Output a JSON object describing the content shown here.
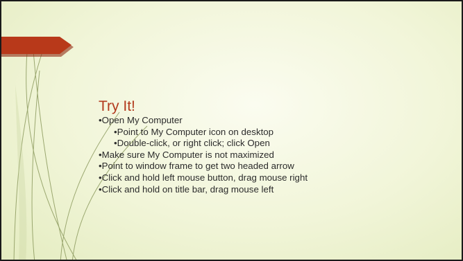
{
  "slide": {
    "title": "Try It!",
    "bullets": [
      {
        "text": "Open My Computer",
        "level": 1
      },
      {
        "text": "Point to My Computer icon on desktop",
        "level": 2
      },
      {
        "text": "Double-click, or right click; click Open",
        "level": 2
      },
      {
        "text": "Make sure My Computer is not maximized",
        "level": 1
      },
      {
        "text": "Point to window frame to get two headed arrow",
        "level": 1
      },
      {
        "text": "Click and hold left mouse button, drag mouse right",
        "level": 1
      },
      {
        "text": "Click and hold on title bar, drag mouse left",
        "level": 1
      }
    ],
    "bullet_char": "•"
  },
  "colors": {
    "title": "#b23a1d",
    "banner": "#b8391a",
    "banner_shadow": "#8f2a12",
    "background": "#f1f5d8",
    "decor_lines": "#8c9a5e",
    "text": "#2b2b2b"
  }
}
